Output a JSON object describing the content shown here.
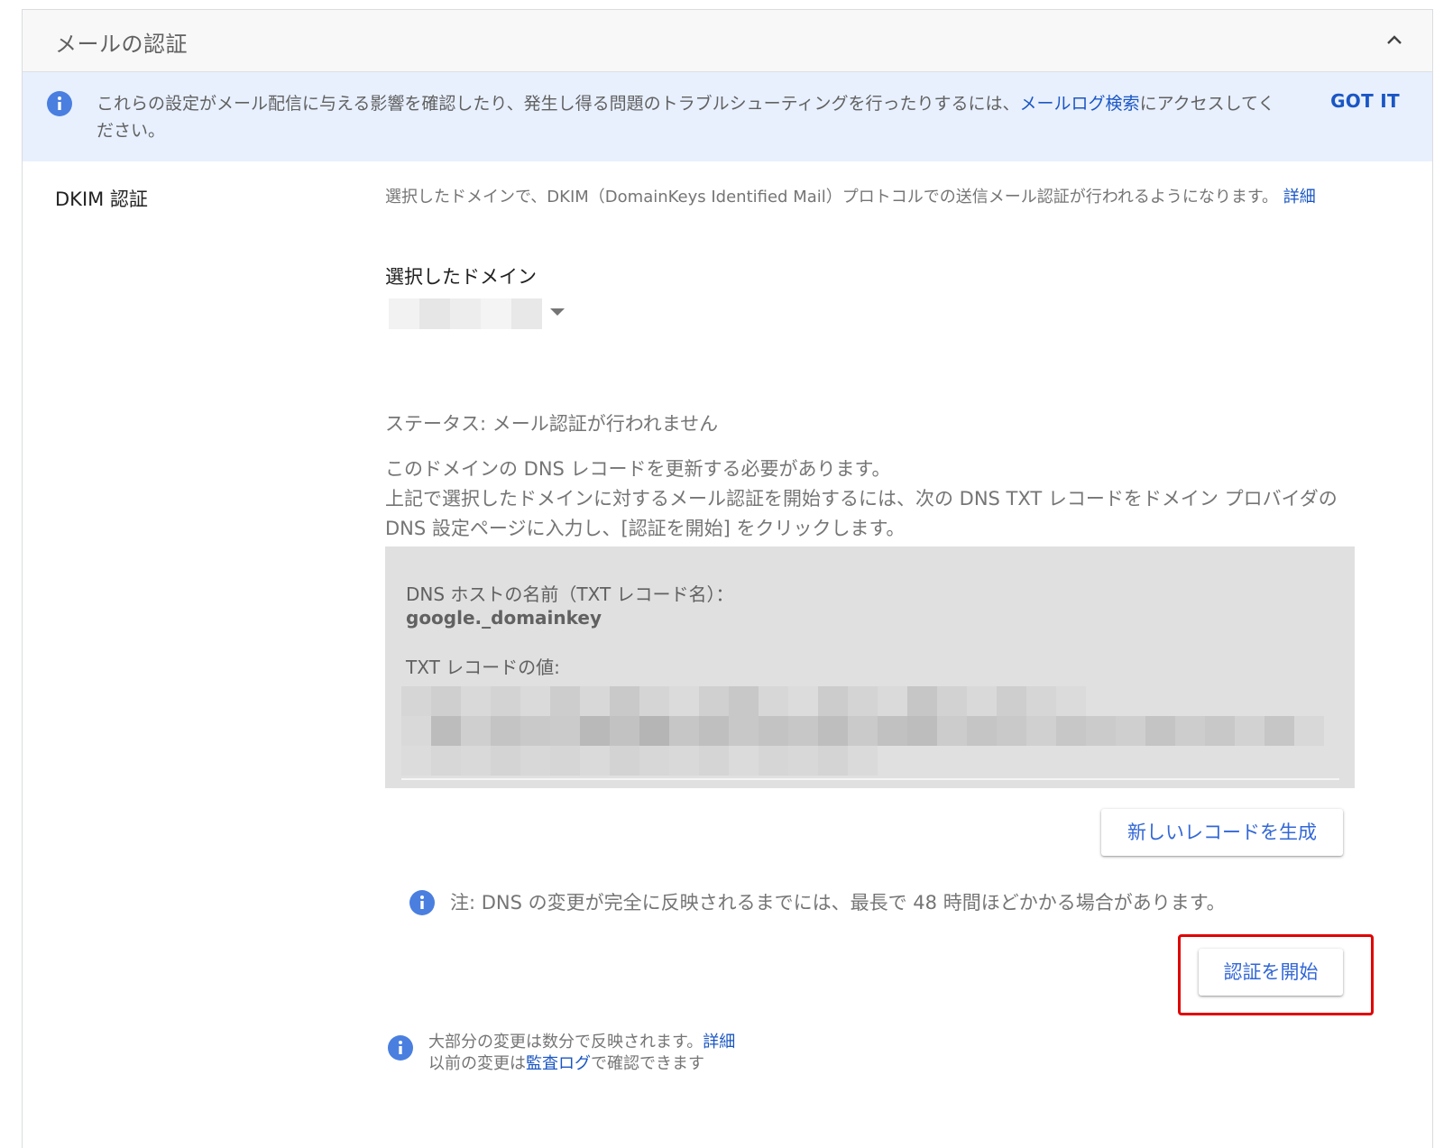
{
  "section": {
    "title": "メールの認証"
  },
  "banner": {
    "text_before": "これらの設定がメール配信に与える影響を確認したり、発生し得る問題のトラブルシューティングを行ったりするには、",
    "link": "メールログ検索",
    "text_after": "にアクセスしてください。",
    "dismiss_label": "GOT IT"
  },
  "dkim": {
    "label": "DKIM 認証",
    "description": "選択したドメインで、DKIM（DomainKeys Identified Mail）プロトコルでの送信メール認証が行われるようになります。",
    "details_link": "詳細",
    "domain_label": "選択したドメイン",
    "domain_value": "",
    "status": "ステータス: メール認証が行われません",
    "instruction_1": "このドメインの DNS レコードを更新する必要があります。",
    "instruction_2": "上記で選択したドメインに対するメール認証を開始するには、次の DNS TXT レコードをドメイン プロバイダの DNS 設定ページに入力し、[認証を開始] をクリックします。",
    "host_label": "DNS ホストの名前（TXT レコード名）：",
    "host_value": "google._domainkey",
    "txt_label": "TXT レコードの値:",
    "txt_value": "",
    "new_record_button": "新しいレコードを生成",
    "note": "注: DNS の変更が完全に反映されるまでには、最長で 48 時間ほどかかる場合があります。",
    "start_button": "認証を開始"
  },
  "footer": {
    "line1_text": "大部分の変更は数分で反映されます。",
    "line1_link": "詳細",
    "line2_before": "以前の変更は",
    "line2_link": "監査ログ",
    "line2_after": "で確認できます"
  },
  "colors": {
    "accent": "#1a56c4",
    "button_text": "#3367d6",
    "banner_bg": "#e8f0fe",
    "info_icon": "#4a7fe0",
    "highlight": "#e00000",
    "record_bg": "#e0e0e0"
  }
}
